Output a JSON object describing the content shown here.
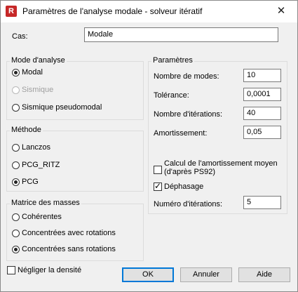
{
  "window": {
    "title": "Paramètres de l'analyse modale - solveur itératif",
    "app_icon_letter": "R",
    "close_glyph": "✕"
  },
  "case": {
    "label": "Cas:",
    "value": "Modale"
  },
  "analysis_mode": {
    "title": "Mode d'analyse",
    "options": [
      {
        "label": "Modal",
        "selected": true,
        "enabled": true
      },
      {
        "label": "Sismique",
        "selected": false,
        "enabled": false
      },
      {
        "label": "Sismique pseudomodal",
        "selected": false,
        "enabled": true
      }
    ]
  },
  "method": {
    "title": "Méthode",
    "options": [
      {
        "label": "Lanczos",
        "selected": false
      },
      {
        "label": "PCG_RITZ",
        "selected": false
      },
      {
        "label": "PCG",
        "selected": true
      }
    ]
  },
  "mass_matrix": {
    "title": "Matrice des masses",
    "options": [
      {
        "label": "Cohérentes",
        "selected": false
      },
      {
        "label": "Concentrées avec rotations",
        "selected": false
      },
      {
        "label": "Concentrées sans rotations",
        "selected": true
      }
    ]
  },
  "parameters": {
    "title": "Paramètres",
    "modes_label": "Nombre de modes:",
    "modes_value": "10",
    "tolerance_label": "Tolérance:",
    "tolerance_value": "0,0001",
    "iterations_label": "Nombre d'itérations:",
    "iterations_value": "40",
    "damping_label": "Amortissement:",
    "damping_value": "0,05",
    "avg_damping_label_line1": "Calcul de l'amortissement moyen",
    "avg_damping_label_line2": "(d'après PS92)",
    "avg_damping_checked": false,
    "phase_shift_label": "Déphasage",
    "phase_shift_checked": true,
    "iteration_number_label": "Numéro d'itérations:",
    "iteration_number_value": "5"
  },
  "ignore_density": {
    "label": "Négliger la densité",
    "checked": false
  },
  "buttons": {
    "ok": "OK",
    "cancel": "Annuler",
    "help": "Aide"
  }
}
